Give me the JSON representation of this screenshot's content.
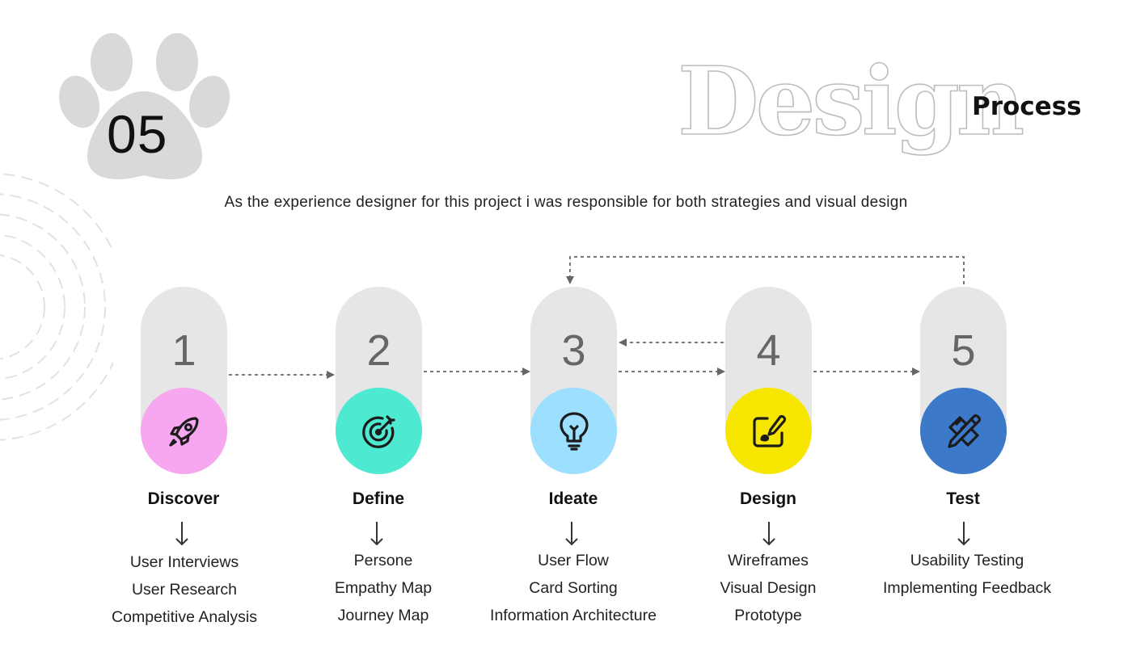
{
  "header": {
    "section_number": "05",
    "title_big": "Design",
    "title_small": "Process",
    "subtitle": "As the experience designer for this project i was responsible for both strategies and visual design"
  },
  "stages": [
    {
      "number": "1",
      "title": "Discover",
      "icon": "rocket-icon",
      "color": "#f6a7f0",
      "items": [
        "User Interviews",
        "User Research",
        "Competitive Analysis"
      ]
    },
    {
      "number": "2",
      "title": "Define",
      "icon": "target-icon",
      "color": "#4ee9d1",
      "items": [
        "Persone",
        "Empathy Map",
        "Journey Map"
      ]
    },
    {
      "number": "3",
      "title": "Ideate",
      "icon": "lightbulb-icon",
      "color": "#9cdfff",
      "items": [
        "User Flow",
        "Card Sorting",
        "Information Architecture"
      ]
    },
    {
      "number": "4",
      "title": "Design",
      "icon": "edit-icon",
      "color": "#f6e600",
      "items": [
        "Wireframes",
        "Visual Design",
        "Prototype"
      ]
    },
    {
      "number": "5",
      "title": "Test",
      "icon": "design-tools-icon",
      "color": "#3d79c9",
      "items": [
        "Usability Testing",
        "Implementing Feedback"
      ]
    }
  ]
}
